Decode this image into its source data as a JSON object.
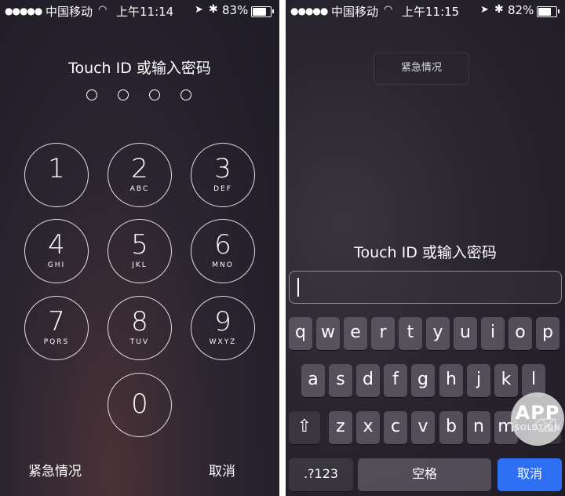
{
  "left": {
    "status": {
      "signal": "●●●●●",
      "carrier": "中国移动",
      "time": "上午11:14",
      "battery_pct": "83%",
      "battery_level": 0.83
    },
    "title": "Touch ID 或输入密码",
    "passcode_dots": 4,
    "keys": [
      {
        "num": "1",
        "letters": ""
      },
      {
        "num": "2",
        "letters": "ABC"
      },
      {
        "num": "3",
        "letters": "DEF"
      },
      {
        "num": "4",
        "letters": "GHI"
      },
      {
        "num": "5",
        "letters": "JKL"
      },
      {
        "num": "6",
        "letters": "MNO"
      },
      {
        "num": "7",
        "letters": "PQRS"
      },
      {
        "num": "8",
        "letters": "TUV"
      },
      {
        "num": "9",
        "letters": "WXYZ"
      },
      {
        "num": "0",
        "letters": ""
      }
    ],
    "emergency": "紧急情况",
    "cancel": "取消"
  },
  "right": {
    "status": {
      "signal": "●●●●●",
      "carrier": "中国移动",
      "time": "上午11:15",
      "battery_pct": "82%",
      "battery_level": 0.82
    },
    "emergency": "紧急情况",
    "title": "Touch ID 或输入密码",
    "keyboard": {
      "row1": [
        "q",
        "w",
        "e",
        "r",
        "t",
        "y",
        "u",
        "i",
        "o",
        "p"
      ],
      "row2": [
        "a",
        "s",
        "d",
        "f",
        "g",
        "h",
        "j",
        "k",
        "l"
      ],
      "row3": [
        "z",
        "x",
        "c",
        "v",
        "b",
        "n",
        "m"
      ],
      "numbers_key": ".?123",
      "space_key": "空格",
      "cancel_key": "取消",
      "shift_icon": "⇧",
      "delete_icon": "⌫"
    }
  },
  "watermark": {
    "line1": "APP",
    "line2": "SOLUTION"
  }
}
